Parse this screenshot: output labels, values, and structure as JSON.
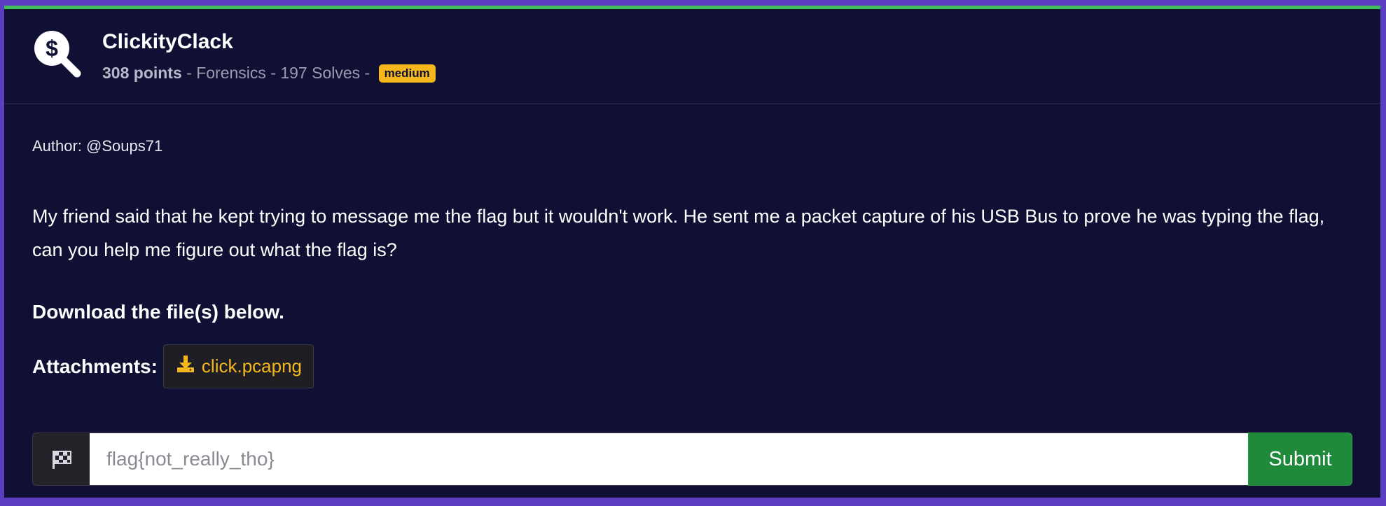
{
  "challenge": {
    "title": "ClickityClack",
    "points": "308 points",
    "category_text": " - Forensics - 197 Solves - ",
    "difficulty": "medium",
    "logo_icon": "dollar-magnifier-icon"
  },
  "body": {
    "author": "Author: @Soups71",
    "description": "My friend said that he kept trying to message me the flag but it wouldn't work. He sent me a packet capture of his USB Bus to prove he was typing the flag, can you help me figure out what the flag is?",
    "download_title": "Download the file(s) below.",
    "attachments_label": "Attachments:",
    "attachments": [
      {
        "name": "click.pcapng",
        "icon": "download-icon"
      }
    ]
  },
  "flag_form": {
    "icon": "checkered-flag-icon",
    "placeholder": "flag{not_really_tho}",
    "value": "",
    "submit_label": "Submit"
  },
  "colors": {
    "background": "#101035",
    "frame": "#5b3fc0",
    "top_accent": "#3fbf5a",
    "badge": "#f5b81c",
    "attachment_text": "#f5b81c",
    "submit": "#1f8a3a"
  }
}
